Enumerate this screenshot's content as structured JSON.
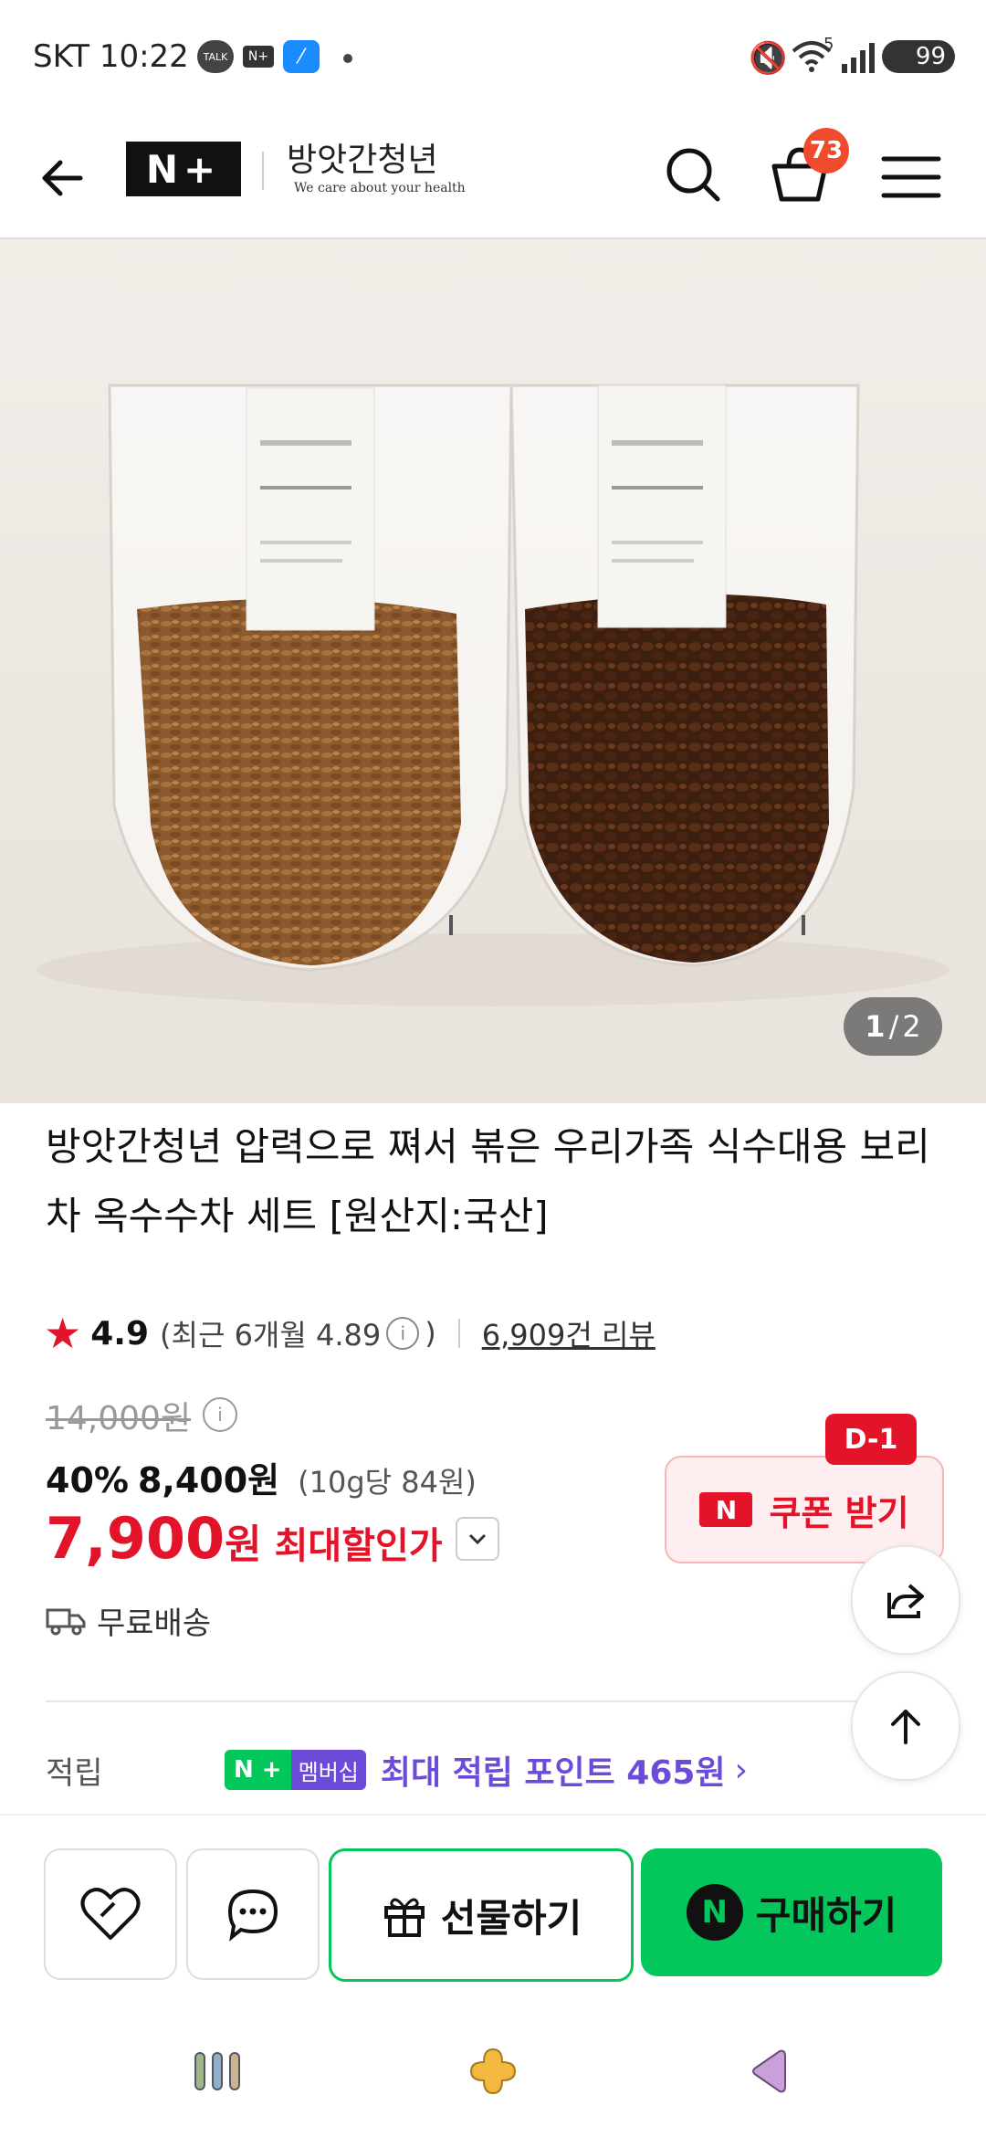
{
  "status_bar": {
    "carrier_time": "SKT 10:22",
    "battery": "99",
    "signal_label": "5",
    "icons": [
      "talk-icon",
      "naver-plus-icon",
      "app-icon",
      "dot-icon",
      "mute-icon",
      "wifi-icon",
      "signal-icon",
      "battery-icon"
    ]
  },
  "header": {
    "brand_logo": "N+",
    "store_name": "방앗간청년",
    "store_tagline": "We care about your health",
    "cart_count": "73"
  },
  "image": {
    "counter_current": "1",
    "counter_sep": "/",
    "counter_total": "2"
  },
  "product": {
    "title": "방앗간청년 압력으로 쪄서 볶은 우리가족 식수대용 보리차 옥수수차 세트 [원산지:국산]",
    "rating": "4.9",
    "recent_rating": "(최근 6개월 4.89",
    "recent_close": ")",
    "review_count": "6,909건 리뷰",
    "original_price": "14,000원",
    "discount_rate": "40%",
    "sale_price": "8,400원",
    "unit_price": "(10g당 84원)",
    "max_price": "7,900",
    "max_price_unit": "원",
    "max_label": "최대할인가",
    "shipping": "무료배송",
    "points_label": "적립",
    "membership_badge": "멤버십",
    "points_text": "최대 적립 포인트 465원"
  },
  "coupon": {
    "dday": "D-1",
    "label": "쿠폰 받기"
  },
  "bottom_bar": {
    "gift_label": "선물하기",
    "buy_label": "구매하기",
    "buy_badge": "N"
  },
  "colors": {
    "accent_red": "#e3142a",
    "naver_green": "#03c75a",
    "points_purple": "#6b4bd8",
    "badge_orange": "#f04b2d"
  }
}
